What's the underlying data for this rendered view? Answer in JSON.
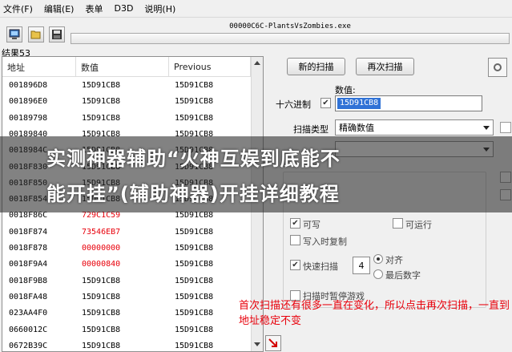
{
  "menu": [
    "文件(F)",
    "编辑(E)",
    "表单",
    "D3D",
    "说明(H)"
  ],
  "process": {
    "title": "00000C6C-PlantsVsZombies.exe"
  },
  "results": {
    "count_label": "结果53",
    "headers": [
      "地址",
      "数值",
      "Previous"
    ],
    "rows": [
      {
        "address": "001896D8",
        "value": "15D91CB8",
        "previous": "15D91CB8",
        "changed": false
      },
      {
        "address": "001896E0",
        "value": "15D91CB8",
        "previous": "15D91CB8",
        "changed": false
      },
      {
        "address": "00189798",
        "value": "15D91CB8",
        "previous": "15D91CB8",
        "changed": false
      },
      {
        "address": "00189840",
        "value": "15D91CB8",
        "previous": "15D91CB8",
        "changed": false
      },
      {
        "address": "0018984C",
        "value": "15D91CB8",
        "previous": "15D91CB8",
        "changed": false
      },
      {
        "address": "0018F830",
        "value": "15D91CB8",
        "previous": "15D91CB8",
        "changed": false
      },
      {
        "address": "0018F850",
        "value": "15D91CB8",
        "previous": "15D91CB8",
        "changed": false
      },
      {
        "address": "0018F854",
        "value": "15D91CB8",
        "previous": "15D91CB8",
        "changed": false
      },
      {
        "address": "0018F86C",
        "value": "729C1C59",
        "previous": "15D91CB8",
        "changed": true
      },
      {
        "address": "0018F874",
        "value": "73546EB7",
        "previous": "15D91CB8",
        "changed": true
      },
      {
        "address": "0018F878",
        "value": "00000000",
        "previous": "15D91CB8",
        "changed": true
      },
      {
        "address": "0018F9A4",
        "value": "00000840",
        "previous": "15D91CB8",
        "changed": true
      },
      {
        "address": "0018F9B8",
        "value": "15D91CB8",
        "previous": "15D91CB8",
        "changed": false
      },
      {
        "address": "0018FA48",
        "value": "15D91CB8",
        "previous": "15D91CB8",
        "changed": false
      },
      {
        "address": "023AA4F0",
        "value": "15D91CB8",
        "previous": "15D91CB8",
        "changed": false
      },
      {
        "address": "0660012C",
        "value": "15D91CB8",
        "previous": "15D91CB8",
        "changed": false
      },
      {
        "address": "0672B39C",
        "value": "15D91CB8",
        "previous": "15D91CB8",
        "changed": false
      }
    ]
  },
  "scan": {
    "new_scan": "新的扫描",
    "next_scan": "再次扫描",
    "value_label": "数值:",
    "hex_label": "十六进制",
    "value": "15D91CB8",
    "scan_type_label": "扫描类型",
    "scan_type_value": "精确数值",
    "writable": "可写",
    "executable": "可运行",
    "copy_on_write": "写入时复制",
    "fast_scan": "快速扫描",
    "fast_scan_value": "4",
    "align": "对齐",
    "last_digits": "最后数字",
    "pause_game": "扫描时暂停游戏"
  },
  "overlay": {
    "line1": "实测神器辅助“火神互娱到底能不",
    "line2": "能开挂”(辅助神器)开挂详细教程"
  },
  "note": "首次扫描还有很多一直在变化，所以点击再次扫描，一直到地址稳定不变",
  "colors": {
    "changed_value": "#e8000b",
    "selection": "#3072d6",
    "note": "#e8000b"
  }
}
